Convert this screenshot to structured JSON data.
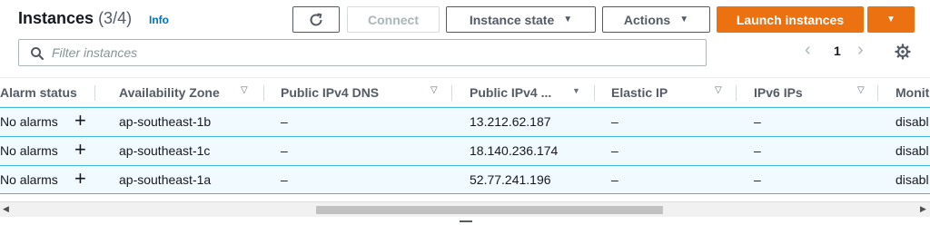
{
  "header": {
    "title": "Instances",
    "count": "(3/4)",
    "info": "Info"
  },
  "toolbar": {
    "refresh_icon": "refresh-icon",
    "connect": "Connect",
    "instance_state": "Instance state",
    "actions": "Actions",
    "launch": "Launch instances"
  },
  "search": {
    "placeholder": "Filter instances",
    "value": ""
  },
  "pagination": {
    "prev": "‹",
    "page": "1",
    "next": "›"
  },
  "columns": [
    "Alarm status",
    "Availability Zone",
    "Public IPv4 DNS",
    "Public IPv4 ...",
    "Elastic IP",
    "IPv6 IPs",
    "Monit"
  ],
  "rows": [
    {
      "alarm": "No alarms",
      "az": "ap-southeast-1b",
      "dns": "–",
      "ip": "13.212.62.187",
      "eip": "–",
      "ipv6": "–",
      "monitoring": "disabl"
    },
    {
      "alarm": "No alarms",
      "az": "ap-southeast-1c",
      "dns": "–",
      "ip": "18.140.236.174",
      "eip": "–",
      "ipv6": "–",
      "monitoring": "disabl"
    },
    {
      "alarm": "No alarms",
      "az": "ap-southeast-1a",
      "dns": "–",
      "ip": "52.77.241.196",
      "eip": "–",
      "ipv6": "–",
      "monitoring": "disabl"
    }
  ],
  "colors": {
    "accent_orange": "#ec7211",
    "link_blue": "#0073bb",
    "selected_row_bg": "#f1faff",
    "selected_row_border": "#44b9d6"
  }
}
